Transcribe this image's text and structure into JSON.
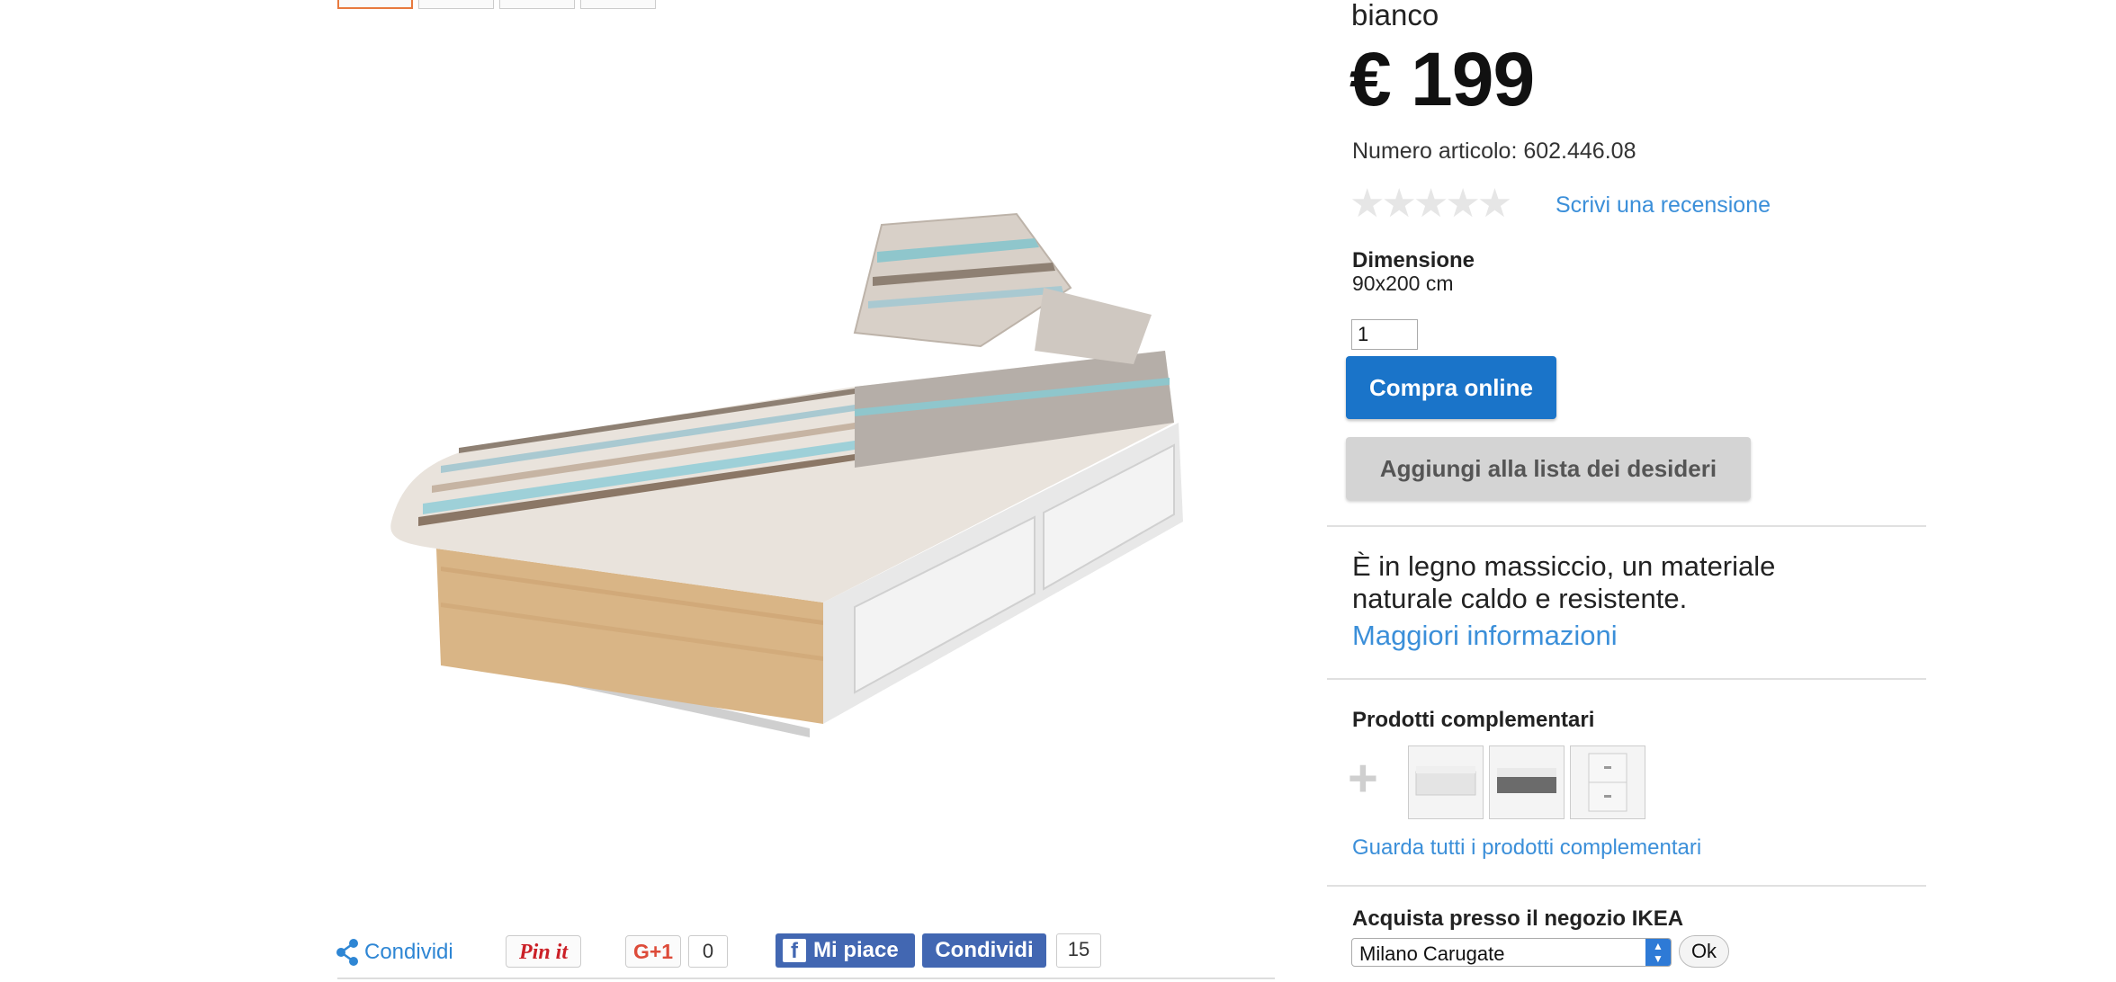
{
  "gallery": {
    "thumbnails": [
      "thumb-1",
      "thumb-2",
      "thumb-3",
      "thumb-4"
    ]
  },
  "product": {
    "color": "bianco",
    "price": "€ 199",
    "article_number": "Numero articolo: 602.446.08",
    "rating_stars": "★★★★★",
    "review_link": "Scrivi una recensione",
    "dimension_label": "Dimensione",
    "dimension_value": "90x200 cm",
    "quantity": "1",
    "buy_button": "Compra online",
    "wishlist_button": "Aggiungi alla lista dei desideri",
    "description": "È in legno massiccio, un materiale naturale caldo e resistente.",
    "more_info_link": "Maggiori informazioni"
  },
  "complementary": {
    "title": "Prodotti complementari",
    "plus": "+",
    "view_all_link": "Guarda tutti i prodotti complementari"
  },
  "store": {
    "title": "Acquista presso il negozio IKEA",
    "selected": "Milano Carugate",
    "ok_button": "Ok"
  },
  "social": {
    "share_label": "Condividi",
    "pinit_label": "Pin it",
    "gplus_label": "G+1",
    "gplus_count": "0",
    "fb_like_label": "Mi piace",
    "fb_share_label": "Condividi",
    "fb_count": "15"
  },
  "colors": {
    "accent_blue": "#1a74c9",
    "link_blue": "#3b8fd9",
    "facebook": "#4267b2",
    "active_thumb": "#e87a3e"
  }
}
